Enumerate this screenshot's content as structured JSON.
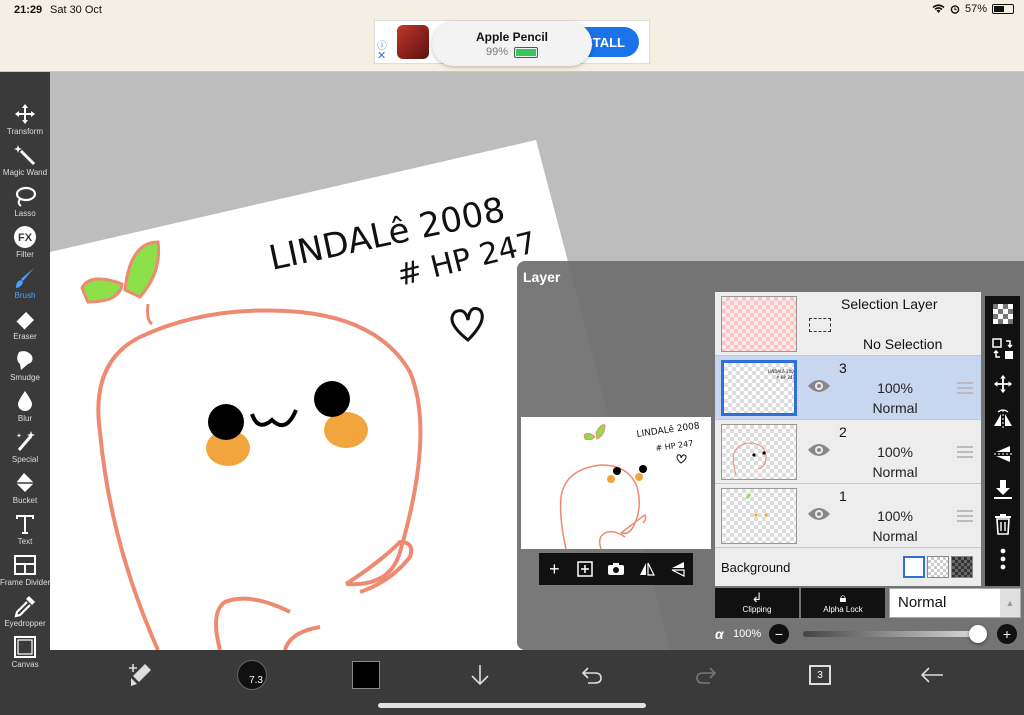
{
  "status": {
    "time": "21:29",
    "date": "Sat 30 Oct",
    "battery": "57%",
    "battery_level": 0.57
  },
  "ad": {
    "install_label": "STALL",
    "info_icon": "info-icon",
    "close_icon": "close-icon"
  },
  "pencil_toast": {
    "title": "Apple Pencil",
    "percent": "99%",
    "level": 0.99,
    "color": "#34c759"
  },
  "toolbar": {
    "items": [
      {
        "label": "Transform",
        "icon": "move-arrows-icon"
      },
      {
        "label": "Magic Wand",
        "icon": "magic-wand-icon"
      },
      {
        "label": "Lasso",
        "icon": "lasso-icon"
      },
      {
        "label": "Filter",
        "icon": "fx-icon"
      },
      {
        "label": "Brush",
        "icon": "brush-icon",
        "active": true
      },
      {
        "label": "Eraser",
        "icon": "eraser-icon"
      },
      {
        "label": "Smudge",
        "icon": "smudge-icon"
      },
      {
        "label": "Blur",
        "icon": "blur-drop-icon"
      },
      {
        "label": "Special",
        "icon": "sparkle-icon"
      },
      {
        "label": "Bucket",
        "icon": "bucket-icon"
      },
      {
        "label": "Text",
        "icon": "text-icon"
      },
      {
        "label": "Frame Divider",
        "icon": "frame-divider-icon"
      },
      {
        "label": "Eyedropper",
        "icon": "eyedropper-icon"
      },
      {
        "label": "Canvas",
        "icon": "canvas-icon"
      }
    ],
    "active_color": "#4aa3ff"
  },
  "canvas": {
    "drawing_text_1": "LINDALê 2008",
    "drawing_text_2": "# HP 247",
    "drawing_face": "ω"
  },
  "layer_panel": {
    "title": "Layer",
    "selection_layer": {
      "title": "Selection Layer",
      "subtitle": "No Selection"
    },
    "layers": [
      {
        "number": "3",
        "opacity": "100%",
        "mode": "Normal",
        "selected": true
      },
      {
        "number": "2",
        "opacity": "100%",
        "mode": "Normal",
        "selected": false
      },
      {
        "number": "1",
        "opacity": "100%",
        "mode": "Normal",
        "selected": false
      }
    ],
    "background_label": "Background",
    "clipping_label": "Clipping",
    "alpha_lock_label": "Alpha Lock",
    "blend_mode": "Normal",
    "alpha_symbol": "α",
    "alpha_value": "100%",
    "alpha_level": 1.0,
    "preview_actions": [
      "add-layer-icon",
      "add-plus-box-icon",
      "camera-icon",
      "flip-horizontal-icon",
      "flip-vertical-icon"
    ],
    "side_icons": [
      "checker-new-layer-icon",
      "swap-layers-icon",
      "move-icon",
      "flip-horizontal-icon",
      "flip-vertical-icon",
      "merge-down-icon",
      "trash-icon",
      "more-icon"
    ]
  },
  "bottom_bar": {
    "brush_size": "7.3",
    "layer_count": "3",
    "icons": [
      "brush-swap-icon",
      "brush-size-icon",
      "color-swatch",
      "import-down-icon",
      "undo-icon",
      "redo-icon",
      "layers-icon",
      "back-arrow-icon"
    ]
  },
  "colors": {
    "accent": "#2f6fd8",
    "outline": "#ee8a72",
    "leaf": "#8ee04a",
    "cheek": "#f2a53c"
  }
}
